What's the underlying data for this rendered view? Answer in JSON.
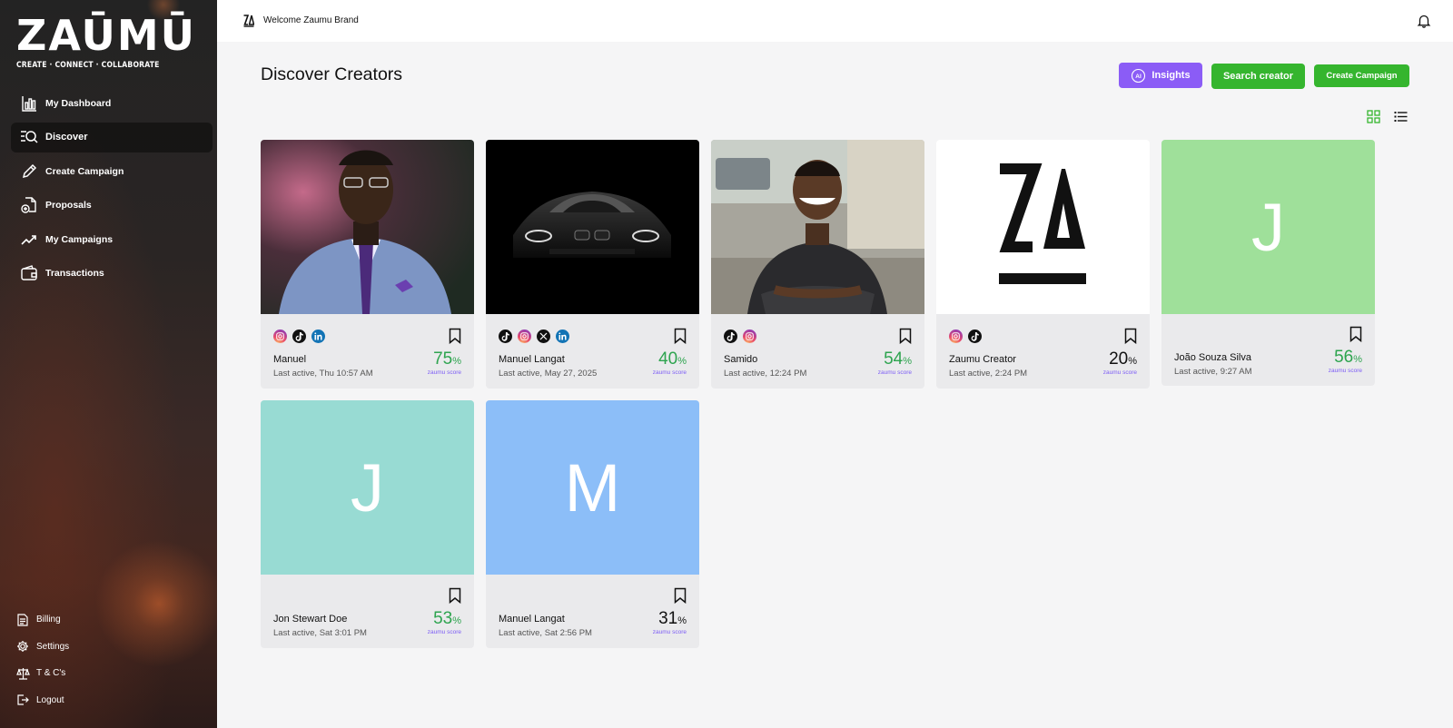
{
  "app": {
    "logo_word": "ZAŪMŪ",
    "logo_tagline": "CREATE · CONNECT · COLLABORATE"
  },
  "sidebar": {
    "items": [
      {
        "label": "My Dashboard",
        "icon": "bar-chart-icon"
      },
      {
        "label": "Discover",
        "icon": "search-list-icon",
        "active": true
      },
      {
        "label": "Create Campaign",
        "icon": "pencil-icon"
      },
      {
        "label": "Proposals",
        "icon": "document-plus-icon"
      },
      {
        "label": "My Campaigns",
        "icon": "trending-up-icon"
      },
      {
        "label": "Transactions",
        "icon": "wallet-icon"
      }
    ],
    "bottom": [
      {
        "label": "Billing",
        "icon": "document-icon"
      },
      {
        "label": "Settings",
        "icon": "gear-icon"
      },
      {
        "label": "T & C's",
        "icon": "scale-icon"
      },
      {
        "label": "Logout",
        "icon": "logout-icon"
      }
    ]
  },
  "topbar": {
    "welcome": "Welcome Zaumu Brand",
    "bell_icon": "bell-icon"
  },
  "page": {
    "title": "Discover Creators",
    "insights_label": "Insights",
    "search_creator_label": "Search creator",
    "create_campaign_label": "Create Campaign"
  },
  "colors": {
    "accent_purple": "#8b5cf6",
    "accent_green": "#35b52e",
    "score_green": "#2ea44f",
    "score_label": "#7c5cf5"
  },
  "creators": [
    {
      "name": "Manuel",
      "last_active": "Last active, Thu 10:57 AM",
      "score": "75",
      "score_color": "green",
      "socials": [
        "instagram",
        "tiktok",
        "linkedin"
      ],
      "media": "photo-man-suit"
    },
    {
      "name": "Manuel Langat",
      "last_active": "Last active, May 27, 2025",
      "score": "40",
      "score_color": "green",
      "socials": [
        "tiktok",
        "instagram",
        "x",
        "linkedin"
      ],
      "media": "photo-black-car"
    },
    {
      "name": "Samido",
      "last_active": "Last active, 12:24 PM",
      "score": "54",
      "score_color": "green",
      "socials": [
        "tiktok",
        "instagram"
      ],
      "media": "photo-man-smiling"
    },
    {
      "name": "Zaumu Creator",
      "last_active": "Last active, 2:24 PM",
      "score": "20",
      "score_color": "dark",
      "socials": [
        "instagram",
        "tiktok"
      ],
      "media": "logo-za"
    },
    {
      "name": "João Souza Silva",
      "last_active": "Last active, 9:27 AM",
      "score": "56",
      "score_color": "green",
      "socials": [],
      "initial": "J",
      "bg": "#9fe09a"
    },
    {
      "name": "Jon Stewart Doe",
      "last_active": "Last active, Sat 3:01 PM",
      "score": "53",
      "score_color": "green",
      "socials": [],
      "initial": "J",
      "bg": "#98dbd3"
    },
    {
      "name": "Manuel Langat",
      "last_active": "Last active, Sat 2:56 PM",
      "score": "31",
      "score_color": "dark",
      "socials": [],
      "initial": "M",
      "bg": "#8cbef8"
    }
  ],
  "score_label": "zaumu score",
  "score_suffix": "%"
}
